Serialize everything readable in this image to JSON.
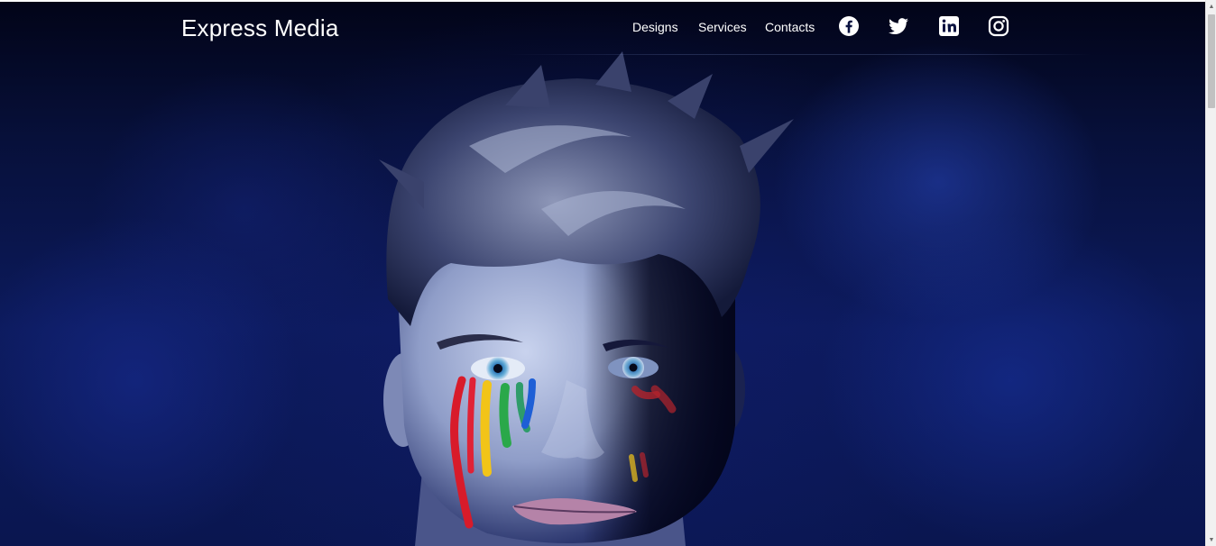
{
  "brand": {
    "name": "Express Media"
  },
  "nav": {
    "items": [
      {
        "label": "Designs"
      },
      {
        "label": "Services"
      },
      {
        "label": "Contacts"
      }
    ],
    "social": [
      "facebook-icon",
      "twitter-icon",
      "linkedin-icon",
      "instagram-icon"
    ]
  },
  "hero": {
    "image": "portrait of a man with rainbow paint tears on a smoky blue background"
  },
  "colors": {
    "nav_text": "#ffffff",
    "backdrop": "#0c1a5c",
    "rainbow": [
      "#d81b2a",
      "#f2c418",
      "#2aa84a",
      "#1e5fd6"
    ]
  }
}
